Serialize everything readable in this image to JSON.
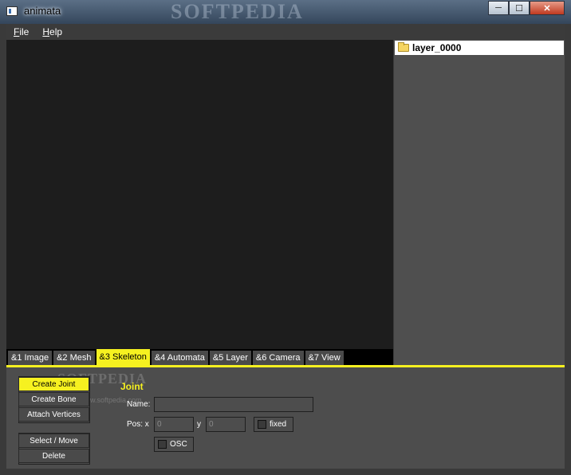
{
  "window": {
    "title": "animata",
    "watermark": "SOFTPEDIA",
    "minimize_glyph": "─",
    "maximize_glyph": "☐",
    "close_glyph": "✕"
  },
  "menu": {
    "file_accel": "F",
    "file_rest": "ile",
    "help_accel": "H",
    "help_rest": "elp"
  },
  "layers": {
    "items": [
      {
        "name": "layer_0000",
        "icon": "folder-icon"
      }
    ]
  },
  "tabs": [
    {
      "label": "&1 Image",
      "active": false
    },
    {
      "label": "&2 Mesh",
      "active": false
    },
    {
      "label": "&3 Skeleton",
      "active": true
    },
    {
      "label": "&4 Automata",
      "active": false
    },
    {
      "label": "&5 Layer",
      "active": false
    },
    {
      "label": "&6 Camera",
      "active": false
    },
    {
      "label": "&7 View",
      "active": false
    }
  ],
  "tools": {
    "create_joint": "Create Joint",
    "create_bone": "Create Bone",
    "attach_vertices": "Attach Vertices",
    "select_move": "Select / Move",
    "delete": "Delete"
  },
  "joint": {
    "title": "Joint",
    "name_label": "Name:",
    "name_value": "",
    "pos_label": "Pos: x",
    "x_value": "0",
    "y_label": "y",
    "y_value": "0",
    "fixed_label": "fixed",
    "osc_label": "OSC"
  },
  "watermark_bottom": {
    "logo": "SOFTPEDIA",
    "url": "www.softpedia.com"
  },
  "colors": {
    "accent": "#f6f120",
    "canvas": "#1d1d1d",
    "panel": "#4d4d4d"
  }
}
